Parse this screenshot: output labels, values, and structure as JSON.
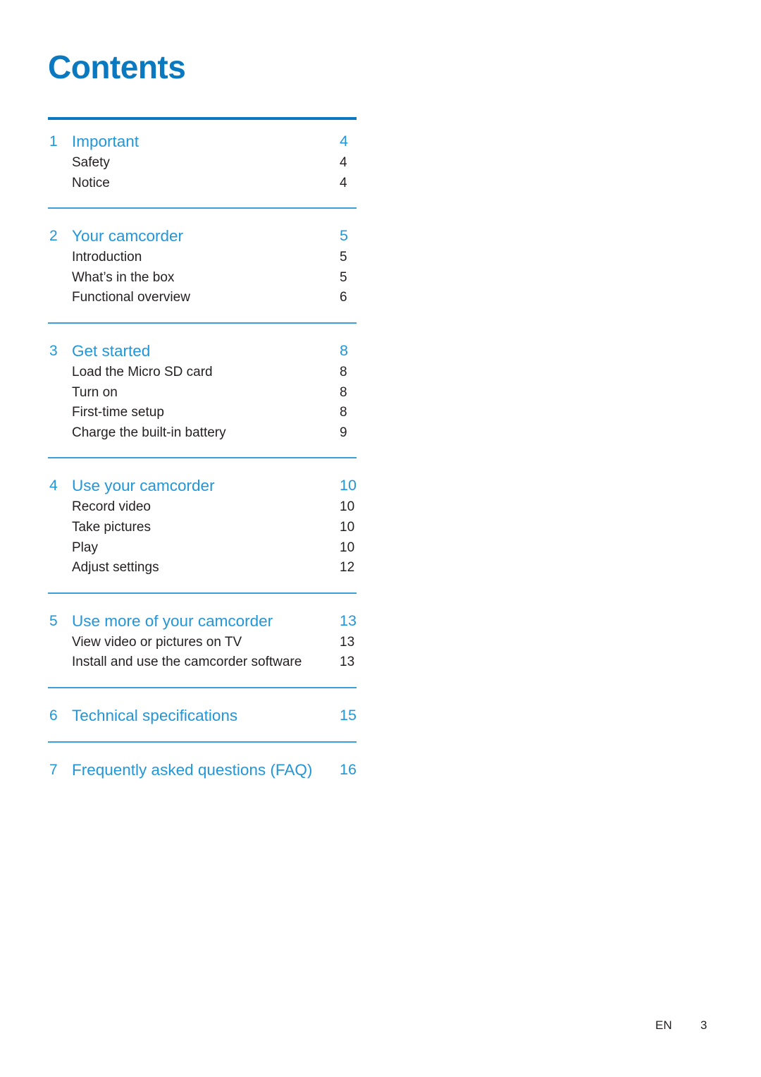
{
  "document": {
    "title": "Contents",
    "accent_color": "#0b79c0",
    "section_color": "#2196d8",
    "rule_color": "#3d9fd8",
    "body_color": "#231f20"
  },
  "toc": {
    "sections": [
      {
        "number": "1",
        "title": "Important",
        "page": "4",
        "entries": [
          {
            "label": "Safety",
            "page": "4"
          },
          {
            "label": "Notice",
            "page": "4"
          }
        ]
      },
      {
        "number": "2",
        "title": "Your camcorder",
        "page": "5",
        "entries": [
          {
            "label": "Introduction",
            "page": "5"
          },
          {
            "label": "What’s in the box",
            "page": "5"
          },
          {
            "label": "Functional overview",
            "page": "6"
          }
        ]
      },
      {
        "number": "3",
        "title": "Get started",
        "page": "8",
        "entries": [
          {
            "label": "Load the Micro SD card",
            "page": "8"
          },
          {
            "label": "Turn on",
            "page": "8"
          },
          {
            "label": "First-time setup",
            "page": "8"
          },
          {
            "label": "Charge the built-in battery",
            "page": "9"
          }
        ]
      },
      {
        "number": "4",
        "title": "Use your camcorder",
        "page": "10",
        "entries": [
          {
            "label": "Record video",
            "page": "10"
          },
          {
            "label": "Take pictures",
            "page": "10"
          },
          {
            "label": "Play",
            "page": "10"
          },
          {
            "label": "Adjust settings",
            "page": "12"
          }
        ]
      },
      {
        "number": "5",
        "title": "Use more of your camcorder",
        "page": "13",
        "entries": [
          {
            "label": "View video or pictures on TV",
            "page": "13"
          },
          {
            "label": "Install and use the camcorder software",
            "page": "13"
          }
        ]
      },
      {
        "number": "6",
        "title": "Technical specifications",
        "page": "15",
        "entries": []
      },
      {
        "number": "7",
        "title": "Frequently asked questions (FAQ)",
        "page": "16",
        "entries": []
      }
    ]
  },
  "footer": {
    "language": "EN",
    "page_number": "3"
  }
}
